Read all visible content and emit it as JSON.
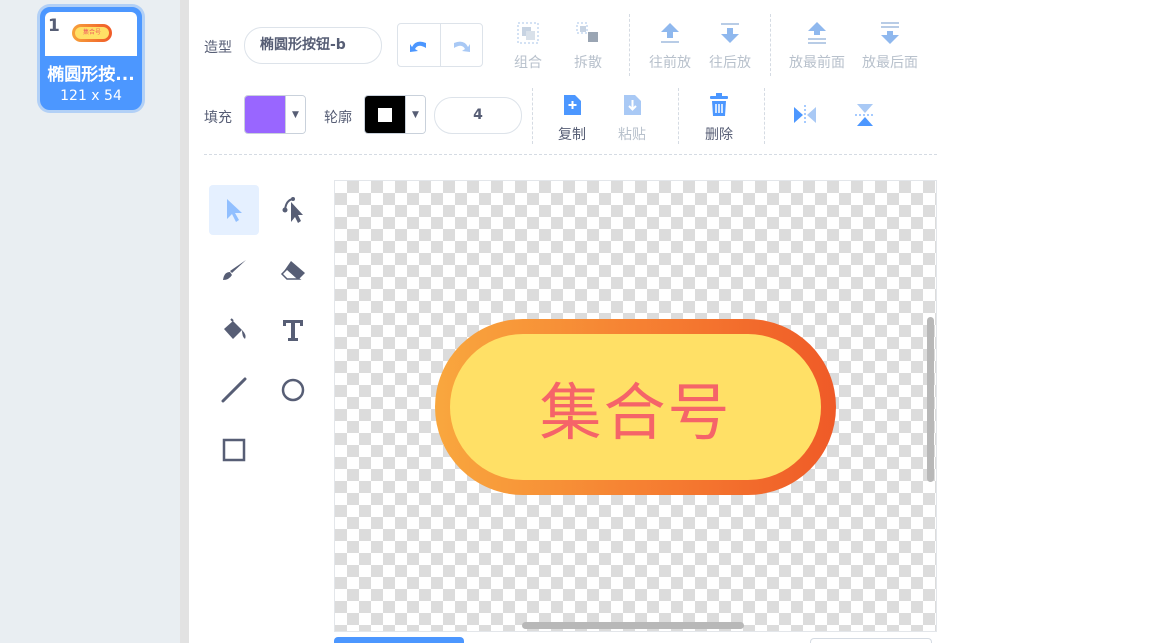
{
  "costume_list": {
    "items": [
      {
        "number": "1",
        "name": "椭圆形按...",
        "size": "121 x 54",
        "thumb_text": "集合号"
      }
    ]
  },
  "toolbar": {
    "costume_label": "造型",
    "costume_name": "椭圆形按钮-b",
    "group": "组合",
    "ungroup": "拆散",
    "forward": "往前放",
    "backward": "往后放",
    "front": "放最前面",
    "back": "放最后面",
    "fill_label": "填充",
    "outline_label": "轮廓",
    "outline_width": "4",
    "copy": "复制",
    "paste": "粘贴",
    "delete": "删除"
  },
  "colors": {
    "fill": "#9966ff",
    "outline": "#000000",
    "accent": "#4c97ff",
    "disabled": "#b8c1cc"
  },
  "canvas": {
    "shape_text": "集合号"
  },
  "icons": [
    "undo-icon",
    "redo-icon",
    "group-icon",
    "ungroup-icon",
    "forward-icon",
    "backward-icon",
    "front-icon",
    "back-icon",
    "copy-icon",
    "paste-icon",
    "delete-icon",
    "flip-horizontal-icon",
    "flip-vertical-icon",
    "select-tool-icon",
    "reshape-tool-icon",
    "brush-tool-icon",
    "eraser-tool-icon",
    "fill-tool-icon",
    "text-tool-icon",
    "line-tool-icon",
    "circle-tool-icon",
    "rectangle-tool-icon"
  ]
}
